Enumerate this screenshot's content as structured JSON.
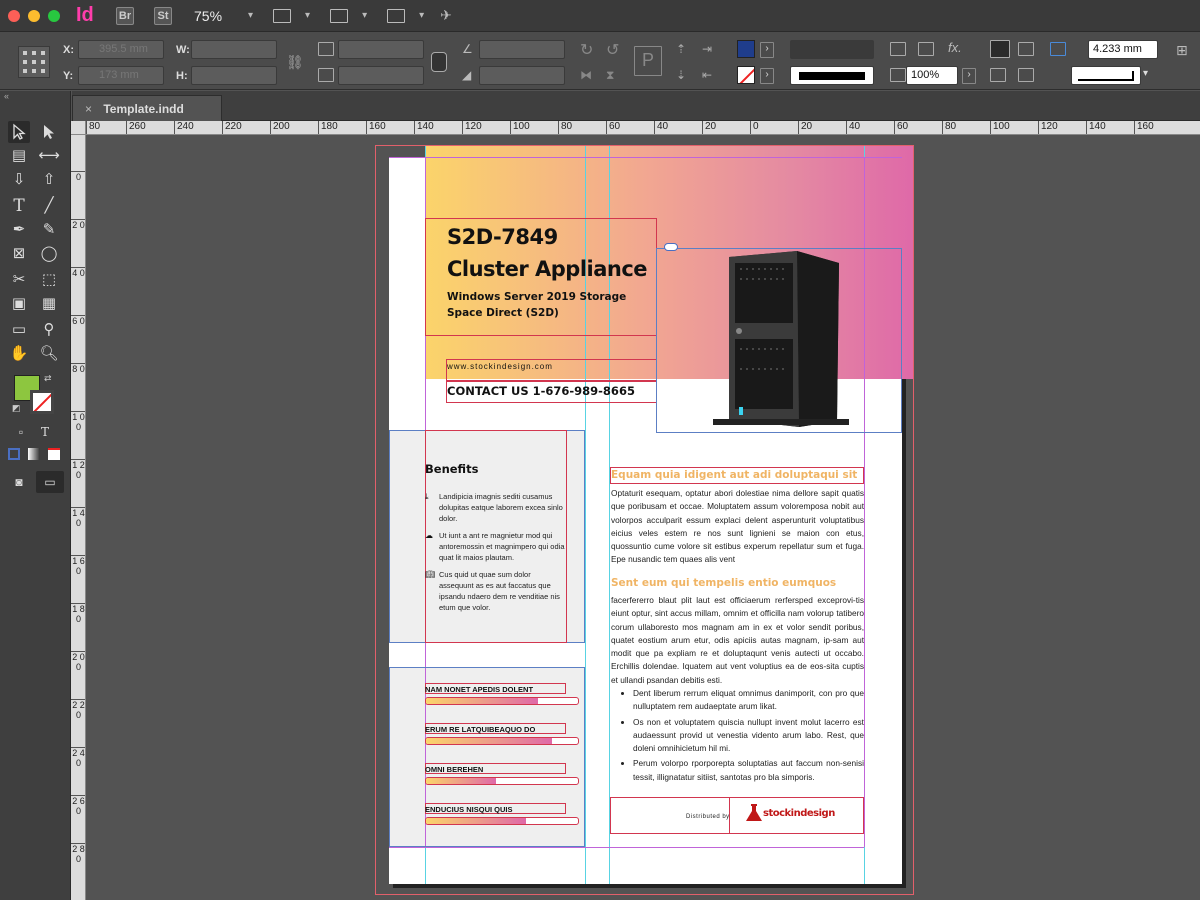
{
  "app": {
    "logo": "Id",
    "bridge_badge": "Br",
    "stock_badge": "St",
    "zoom": "75%"
  },
  "control_panel": {
    "x_label": "X:",
    "y_label": "Y:",
    "w_label": "W:",
    "h_label": "H:",
    "x_value": "395.5 mm",
    "y_value": "173 mm",
    "stroke_weight": "4.233 mm",
    "opacity": "100%",
    "fill_color": "#1f3d8c"
  },
  "document": {
    "tab_close": "×",
    "tab_title": "Template.indd"
  },
  "tools": {
    "fill_color": "#8dc63f",
    "text_tool": "T",
    "format_text": "T"
  },
  "rulers": {
    "h_ticks": [
      "80",
      "260",
      "240",
      "220",
      "200",
      "180",
      "160",
      "140",
      "120",
      "100",
      "80",
      "60",
      "40",
      "20",
      "0",
      "20",
      "40",
      "60",
      "80",
      "100",
      "120",
      "140",
      "160"
    ],
    "v_ticks": [
      "0",
      "2 0",
      "4 0",
      "6 0",
      "8 0",
      "1 0 0",
      "1 2 0",
      "1 4 0",
      "1 6 0",
      "1 8 0",
      "2 0 0",
      "2 2 0",
      "2 4 0",
      "2 6 0",
      "2 8 0"
    ]
  },
  "page": {
    "title_line1": "S2D-7849",
    "title_line2": "Cluster Appliance",
    "subtitle_line1": "Windows Server 2019 Storage",
    "subtitle_line2": "Space Direct (S2D)",
    "url": "www.stockindesign.com",
    "contact": "CONTACT US 1-676-989-8665",
    "benefits_heading": "Benefits",
    "benefits": [
      "Landipicia imagnis sediti cusamus dolupitas eatque laborem excea sinlo dolor.",
      "Ut iunt a ant re magnietur mod qui antoremossin et magnimpero qui odia quat lit maios plautam.",
      "Cus quid ut quae sum dolor assequunt as es aut faccatus que ipsandu ndaero dem re venditiae nis etum que volor."
    ],
    "bars": [
      {
        "label": "NAM NONET APEDIS DOLENT",
        "value": 0.74
      },
      {
        "label": "ERUM RE LATQUIBEAQUO DO",
        "value": 0.83
      },
      {
        "label": "OMNI BEREHEN",
        "value": 0.46
      },
      {
        "label": "ENDUCIUS NISQUI QUIS",
        "value": 0.66
      }
    ],
    "article_h1": "Equam quia idigent aut adi doluptaqui sit",
    "article_p1": "Optaturit esequam, optatur abori dolestiae nima dellore sapit quatis que poribusam et occae. Moluptatem assum voloremposa nobit aut volorpos acculparit essum explaci delent asperunturit voluptatibus eicius veles estem re nos sunt lignieni se maion con etus, quossuntio cume volore sit estibus experum repellatur sum et fuga. Epe nusandic tem quaes alis vent",
    "article_h2": "Sent eum qui tempelis entio eumquos",
    "article_p2": "facerfererro blaut plit laut est officiaerum rerfersped exceprovi-tis eiunt optur, sint accus millam, omnim et officilla nam volorup tatibero corum ullaboresto mos magnam am in ex et volor sendit poribus, quatet eostium arum etur, odis apiciis autas magnam, ip-sam aut modit que pa expliam re et doluptaqunt venis autecti ut occabo. Erchillis dolendae. Iquatem aut vent voluptius ea de eos-sita cuptis et ullandi psandan debitis esti.",
    "article_list": [
      "Dent liberum rerrum eliquat omnimus danimporit, con pro que nulluptatem rem audaeptate arum likat.",
      "Os non et voluptatem quiscia nullupt invent molut lacerro est audaessunt provid ut venestia vidento arum labo. Rest, que doleni omnihicietum hil mi.",
      "Perum volorpo rporporepta soluptatias aut faccum non-senisi tessit, illignatatur sitiist, santotas pro bla simporis."
    ],
    "distributed_by": "Distributed by",
    "logo_text": "stockindesign"
  }
}
